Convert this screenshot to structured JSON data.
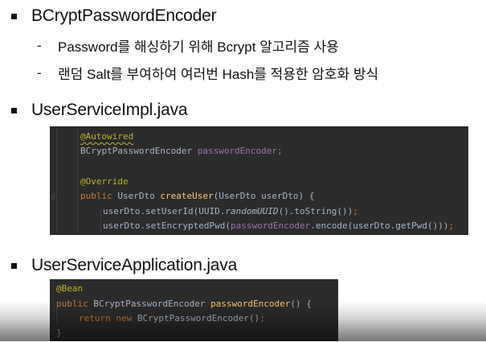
{
  "section1": {
    "title": "BCryptPasswordEncoder",
    "points": [
      "Password를 해싱하기 위해 Bcrypt 알고리즘 사용",
      "랜덤 Salt를 부여하여 여러번 Hash를 적용한 암호화 방식"
    ],
    "dash": "-"
  },
  "section2": {
    "title": "UserServiceImpl.java",
    "code": {
      "annotation1": "@Autowired",
      "field_type": "BCryptPasswordEncoder ",
      "field_name": "passwordEncoder",
      "semicolon": ";",
      "annotation2": "@Override",
      "kw_public": "public ",
      "method_return": "UserDto ",
      "method_name": "createUser",
      "method_params": "(UserDto userDto) {",
      "l1_a": "userDto.setUserId(UUID.",
      "l1_b": "randomUUID",
      "l1_c": "().toString())",
      "l1_d": ";",
      "l2_a": "userDto.setEncryptedPwd(",
      "l2_b": "passwordEncoder",
      "l2_c": ".encode(userDto.getPwd()))",
      "l2_d": ";"
    }
  },
  "section3": {
    "title": "UserServiceApplication.java",
    "code": {
      "annotation": "@Bean",
      "kw_public": "public ",
      "return_type": "BCryptPasswordEncoder ",
      "method_name": "passwordEncoder",
      "method_rest": "() {",
      "kw_return": "return ",
      "kw_new": "new ",
      "ctor": "BCryptPasswordEncoder()",
      "semi": ";",
      "close": "}"
    }
  }
}
